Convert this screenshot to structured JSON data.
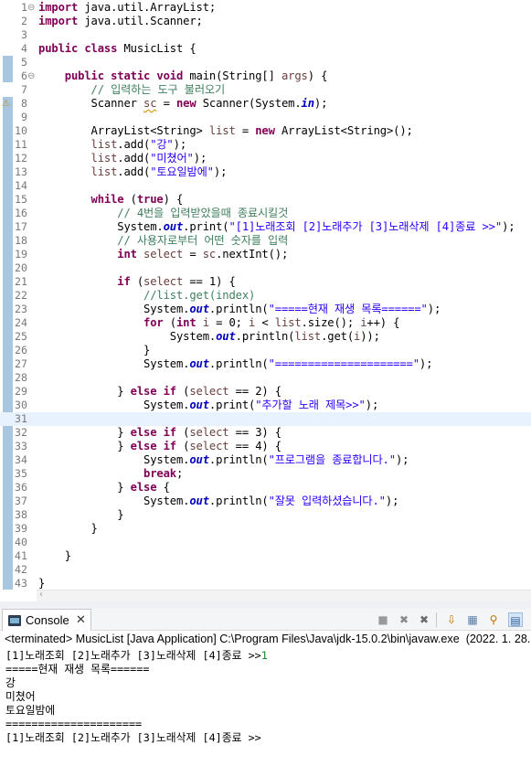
{
  "editor": {
    "lines": [
      {
        "n": "1",
        "fold": "⊖",
        "tokens": [
          {
            "t": "import",
            "c": "kw"
          },
          {
            "t": " java.util.ArrayList;"
          }
        ]
      },
      {
        "n": "2",
        "tokens": [
          {
            "t": "import",
            "c": "kw"
          },
          {
            "t": " java.util.Scanner;"
          }
        ]
      },
      {
        "n": "3",
        "tokens": []
      },
      {
        "n": "4",
        "tokens": [
          {
            "t": "public",
            "c": "kw"
          },
          {
            "t": " "
          },
          {
            "t": "class",
            "c": "kw"
          },
          {
            "t": " MusicList {"
          }
        ]
      },
      {
        "n": "5",
        "tokens": []
      },
      {
        "n": "6",
        "fold": "⊖",
        "tokens": [
          {
            "t": "    "
          },
          {
            "t": "public",
            "c": "kw"
          },
          {
            "t": " "
          },
          {
            "t": "static",
            "c": "kw"
          },
          {
            "t": " "
          },
          {
            "t": "void",
            "c": "kw"
          },
          {
            "t": " main(String[] "
          },
          {
            "t": "args",
            "c": "var"
          },
          {
            "t": ") {"
          }
        ]
      },
      {
        "n": "7",
        "tokens": [
          {
            "t": "        "
          },
          {
            "t": "// 입력하는 도구 불러오기",
            "c": "cmt"
          }
        ]
      },
      {
        "n": "8",
        "warn": true,
        "tokens": [
          {
            "t": "        Scanner "
          },
          {
            "t": "sc",
            "c": "var ul"
          },
          {
            "t": " = "
          },
          {
            "t": "new",
            "c": "kw"
          },
          {
            "t": " Scanner(System."
          },
          {
            "t": "in",
            "c": "fld"
          },
          {
            "t": ");"
          }
        ]
      },
      {
        "n": "9",
        "tokens": []
      },
      {
        "n": "10",
        "tokens": [
          {
            "t": "        ArrayList<String> "
          },
          {
            "t": "list",
            "c": "var"
          },
          {
            "t": " = "
          },
          {
            "t": "new",
            "c": "kw"
          },
          {
            "t": " ArrayList<String>();"
          }
        ]
      },
      {
        "n": "11",
        "tokens": [
          {
            "t": "        "
          },
          {
            "t": "list",
            "c": "var"
          },
          {
            "t": ".add("
          },
          {
            "t": "\"강\"",
            "c": "str"
          },
          {
            "t": ");"
          }
        ]
      },
      {
        "n": "12",
        "tokens": [
          {
            "t": "        "
          },
          {
            "t": "list",
            "c": "var"
          },
          {
            "t": ".add("
          },
          {
            "t": "\"미쳤어\"",
            "c": "str"
          },
          {
            "t": ");"
          }
        ]
      },
      {
        "n": "13",
        "tokens": [
          {
            "t": "        "
          },
          {
            "t": "list",
            "c": "var"
          },
          {
            "t": ".add("
          },
          {
            "t": "\"토요일밤에\"",
            "c": "str"
          },
          {
            "t": ");"
          }
        ]
      },
      {
        "n": "14",
        "tokens": []
      },
      {
        "n": "15",
        "tokens": [
          {
            "t": "        "
          },
          {
            "t": "while",
            "c": "kw"
          },
          {
            "t": " ("
          },
          {
            "t": "true",
            "c": "kw"
          },
          {
            "t": ") {"
          }
        ]
      },
      {
        "n": "16",
        "tokens": [
          {
            "t": "            "
          },
          {
            "t": "// 4번을 입력받았을때 종료시킬것",
            "c": "cmt"
          }
        ]
      },
      {
        "n": "17",
        "tokens": [
          {
            "t": "            System."
          },
          {
            "t": "out",
            "c": "fld"
          },
          {
            "t": ".print("
          },
          {
            "t": "\"[1]노래조회 [2]노래추가 [3]노래삭제 [4]종료 >>\"",
            "c": "str"
          },
          {
            "t": ");"
          }
        ]
      },
      {
        "n": "18",
        "tokens": [
          {
            "t": "            "
          },
          {
            "t": "// 사용자로부터 어떤 숫자를 입력",
            "c": "cmt"
          }
        ]
      },
      {
        "n": "19",
        "tokens": [
          {
            "t": "            "
          },
          {
            "t": "int",
            "c": "kw"
          },
          {
            "t": " "
          },
          {
            "t": "select",
            "c": "var"
          },
          {
            "t": " = "
          },
          {
            "t": "sc",
            "c": "var"
          },
          {
            "t": ".nextInt();"
          }
        ]
      },
      {
        "n": "20",
        "tokens": []
      },
      {
        "n": "21",
        "tokens": [
          {
            "t": "            "
          },
          {
            "t": "if",
            "c": "kw"
          },
          {
            "t": " ("
          },
          {
            "t": "select",
            "c": "var"
          },
          {
            "t": " == 1) {"
          }
        ]
      },
      {
        "n": "22",
        "tokens": [
          {
            "t": "                "
          },
          {
            "t": "//list.get(index)",
            "c": "cmt"
          }
        ]
      },
      {
        "n": "23",
        "tokens": [
          {
            "t": "                System."
          },
          {
            "t": "out",
            "c": "fld"
          },
          {
            "t": ".println("
          },
          {
            "t": "\"=====현재 재생 목록======\"",
            "c": "str"
          },
          {
            "t": ");"
          }
        ]
      },
      {
        "n": "24",
        "tokens": [
          {
            "t": "                "
          },
          {
            "t": "for",
            "c": "kw"
          },
          {
            "t": " ("
          },
          {
            "t": "int",
            "c": "kw"
          },
          {
            "t": " "
          },
          {
            "t": "i",
            "c": "var"
          },
          {
            "t": " = 0; "
          },
          {
            "t": "i",
            "c": "var"
          },
          {
            "t": " < "
          },
          {
            "t": "list",
            "c": "var"
          },
          {
            "t": ".size(); "
          },
          {
            "t": "i",
            "c": "var"
          },
          {
            "t": "++) {"
          }
        ]
      },
      {
        "n": "25",
        "tokens": [
          {
            "t": "                    System."
          },
          {
            "t": "out",
            "c": "fld"
          },
          {
            "t": ".println("
          },
          {
            "t": "list",
            "c": "var"
          },
          {
            "t": ".get("
          },
          {
            "t": "i",
            "c": "var"
          },
          {
            "t": "));"
          }
        ]
      },
      {
        "n": "26",
        "tokens": [
          {
            "t": "                }"
          }
        ]
      },
      {
        "n": "27",
        "tokens": [
          {
            "t": "                System."
          },
          {
            "t": "out",
            "c": "fld"
          },
          {
            "t": ".println("
          },
          {
            "t": "\"=====================\"",
            "c": "str"
          },
          {
            "t": ");"
          }
        ]
      },
      {
        "n": "28",
        "tokens": []
      },
      {
        "n": "29",
        "tokens": [
          {
            "t": "            } "
          },
          {
            "t": "else",
            "c": "kw"
          },
          {
            "t": " "
          },
          {
            "t": "if",
            "c": "kw"
          },
          {
            "t": " ("
          },
          {
            "t": "select",
            "c": "var"
          },
          {
            "t": " == 2) {"
          }
        ]
      },
      {
        "n": "30",
        "tokens": [
          {
            "t": "                System."
          },
          {
            "t": "out",
            "c": "fld"
          },
          {
            "t": ".print("
          },
          {
            "t": "\"추가할 노래 제목>>\"",
            "c": "str"
          },
          {
            "t": ");"
          }
        ]
      },
      {
        "n": "31",
        "current": true,
        "tokens": []
      },
      {
        "n": "32",
        "tokens": [
          {
            "t": "            } "
          },
          {
            "t": "else",
            "c": "kw"
          },
          {
            "t": " "
          },
          {
            "t": "if",
            "c": "kw"
          },
          {
            "t": " ("
          },
          {
            "t": "select",
            "c": "var"
          },
          {
            "t": " == 3) {"
          }
        ]
      },
      {
        "n": "33",
        "tokens": [
          {
            "t": "            } "
          },
          {
            "t": "else",
            "c": "kw"
          },
          {
            "t": " "
          },
          {
            "t": "if",
            "c": "kw"
          },
          {
            "t": " ("
          },
          {
            "t": "select",
            "c": "var"
          },
          {
            "t": " == 4) {"
          }
        ]
      },
      {
        "n": "34",
        "tokens": [
          {
            "t": "                System."
          },
          {
            "t": "out",
            "c": "fld"
          },
          {
            "t": ".println("
          },
          {
            "t": "\"프로그램을 종료합니다.\"",
            "c": "str"
          },
          {
            "t": ");"
          }
        ]
      },
      {
        "n": "35",
        "tokens": [
          {
            "t": "                "
          },
          {
            "t": "break",
            "c": "kw"
          },
          {
            "t": ";"
          }
        ]
      },
      {
        "n": "36",
        "tokens": [
          {
            "t": "            } "
          },
          {
            "t": "else",
            "c": "kw"
          },
          {
            "t": " {"
          }
        ]
      },
      {
        "n": "37",
        "tokens": [
          {
            "t": "                System."
          },
          {
            "t": "out",
            "c": "fld"
          },
          {
            "t": ".println("
          },
          {
            "t": "\"잘못 입력하셨습니다.\"",
            "c": "str"
          },
          {
            "t": ");"
          }
        ]
      },
      {
        "n": "38",
        "tokens": [
          {
            "t": "            }"
          }
        ]
      },
      {
        "n": "39",
        "tokens": [
          {
            "t": "        }"
          }
        ]
      },
      {
        "n": "40",
        "tokens": []
      },
      {
        "n": "41",
        "tokens": [
          {
            "t": "    }"
          }
        ]
      },
      {
        "n": "42",
        "tokens": []
      },
      {
        "n": "43",
        "tokens": [
          {
            "t": "}"
          }
        ]
      }
    ]
  },
  "console": {
    "tab_label": "Console",
    "tab_icon": "console-icon",
    "header": "<terminated> MusicList [Java Application] C:\\Program Files\\Java\\jdk-15.0.2\\bin\\javaw.exe  (2022. 1. 28.",
    "toolbar_icons": [
      "terminate-icon",
      "remove-launch-icon",
      "remove-all-icon",
      "scroll-lock-icon",
      "word-wrap-icon",
      "pin-console-icon",
      "display-selected-console-icon"
    ],
    "output": [
      {
        "text": "[1]노래조회 [2]노래추가 [3]노래삭제 [4]종료 >>",
        "input": "1"
      },
      {
        "text": "=====현재 재생 목록======"
      },
      {
        "text": "강"
      },
      {
        "text": "미쳤어"
      },
      {
        "text": "토요일밤에"
      },
      {
        "text": "====================="
      },
      {
        "text": "[1]노래조회 [2]노래추가 [3]노래삭제 [4]종료 >>"
      }
    ]
  },
  "colors": {
    "keyword": "#7f0055",
    "string": "#2a00ff",
    "comment": "#3f7f5f",
    "field": "#0000c0",
    "console_input": "#0a8c2c"
  }
}
